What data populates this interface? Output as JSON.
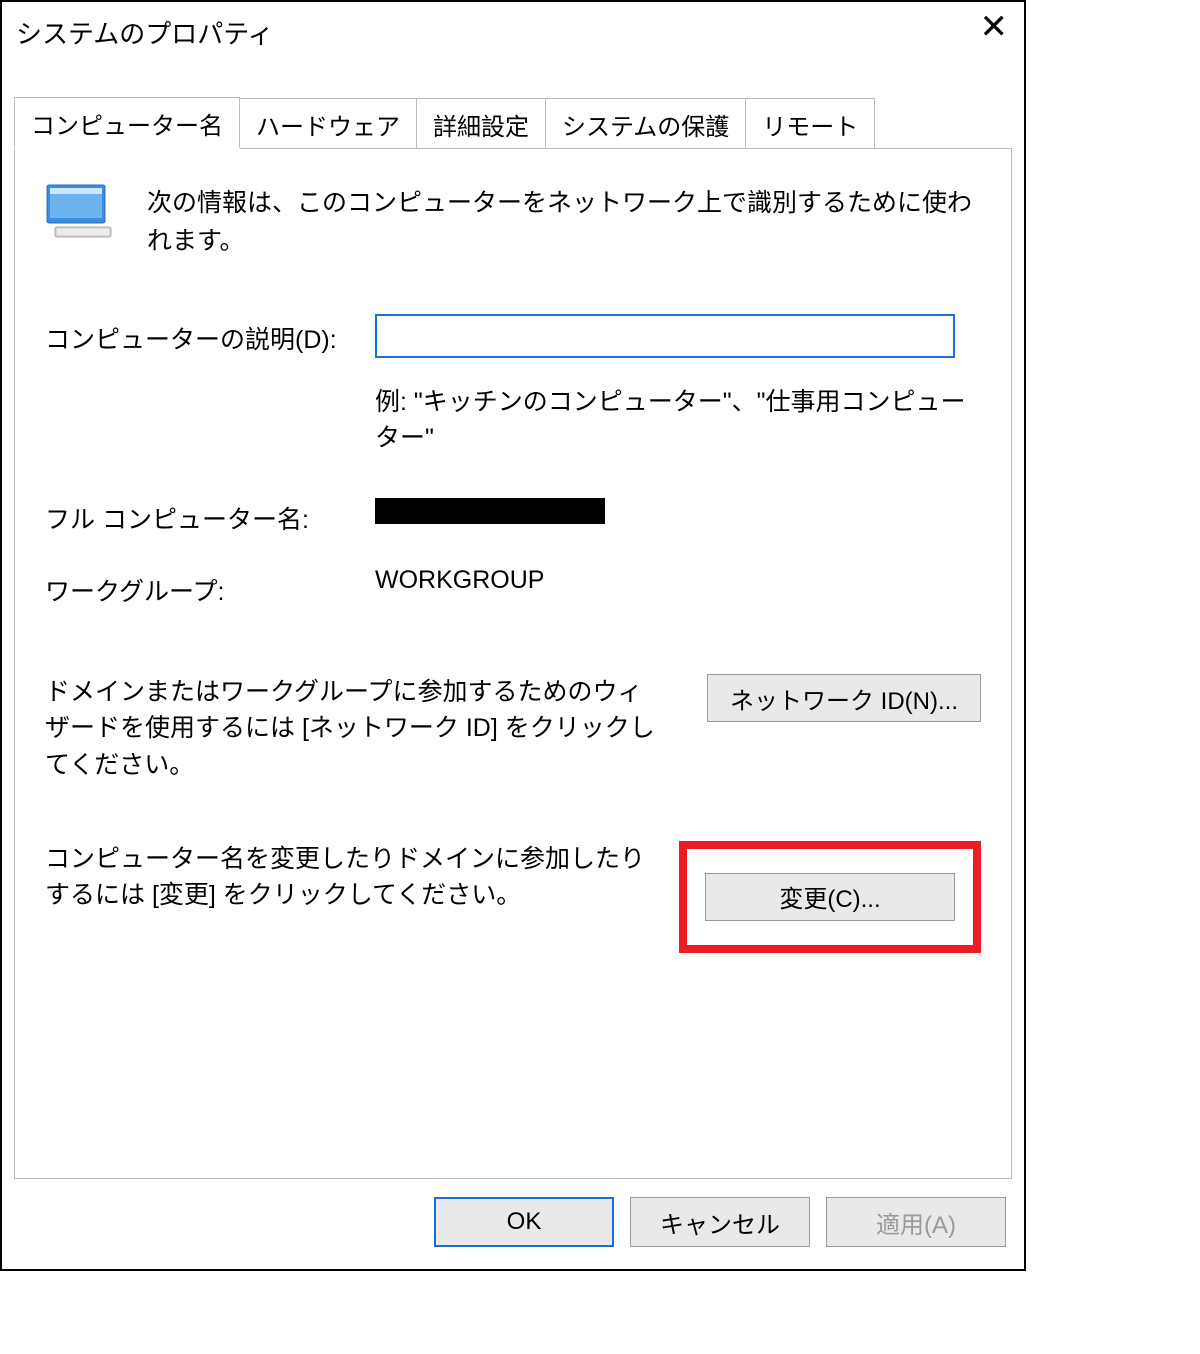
{
  "window": {
    "title": "システムのプロパティ"
  },
  "tabs": {
    "computer_name": "コンピューター名",
    "hardware": "ハードウェア",
    "advanced": "詳細設定",
    "system_protection": "システムの保護",
    "remote": "リモート"
  },
  "panel": {
    "intro": "次の情報は、このコンピューターをネットワーク上で識別するために使われます。",
    "desc_label": "コンピューターの説明(D):",
    "desc_value": "",
    "desc_example": "例: \"キッチンのコンピューター\"、\"仕事用コンピューター\"",
    "full_name_label": "フル コンピューター名:",
    "workgroup_label": "ワークグループ:",
    "workgroup_value": "WORKGROUP",
    "network_id_text": "ドメインまたはワークグループに参加するためのウィザードを使用するには [ネットワーク ID] をクリックしてください。",
    "network_id_button": "ネットワーク ID(N)...",
    "change_text": "コンピューター名を変更したりドメインに参加したりするには [変更] をクリックしてください。",
    "change_button": "変更(C)..."
  },
  "footer": {
    "ok": "OK",
    "cancel": "キャンセル",
    "apply": "適用(A)"
  }
}
